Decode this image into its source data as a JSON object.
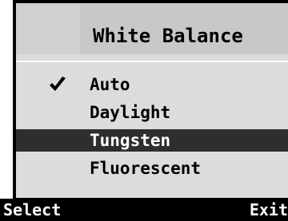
{
  "menu": {
    "title": "White Balance",
    "selected_index": 0,
    "highlighted_index": 2,
    "items": [
      {
        "label": "Auto",
        "checked": true
      },
      {
        "label": "Daylight",
        "checked": false
      },
      {
        "label": "Tungsten",
        "checked": false
      },
      {
        "label": "Fluorescent",
        "checked": false
      }
    ]
  },
  "softkeys": {
    "left_label": "Select",
    "right_label": "Exit"
  },
  "icons": {
    "check": "check-icon"
  },
  "colors": {
    "panel_background": "#dcdcdc",
    "title_background": "#c8c8c8",
    "highlight_background": "#2e2e2e",
    "softkey_background": "#000000",
    "text_dark": "#000000",
    "text_light": "#ffffff"
  }
}
